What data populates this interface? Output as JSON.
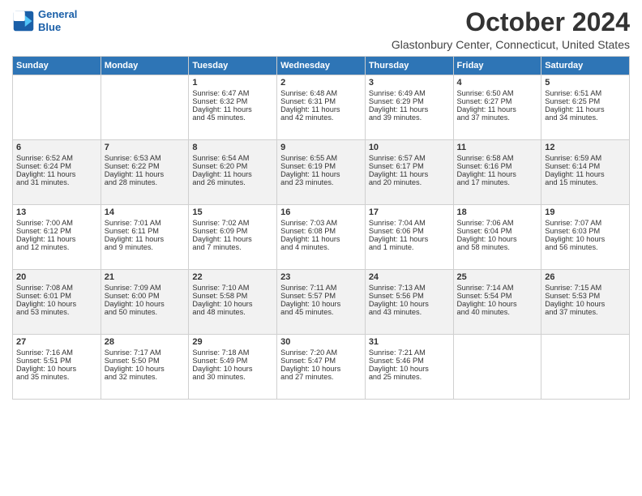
{
  "logo": {
    "line1": "General",
    "line2": "Blue"
  },
  "title": "October 2024",
  "location": "Glastonbury Center, Connecticut, United States",
  "headers": [
    "Sunday",
    "Monday",
    "Tuesday",
    "Wednesday",
    "Thursday",
    "Friday",
    "Saturday"
  ],
  "weeks": [
    [
      {
        "day": "",
        "lines": []
      },
      {
        "day": "",
        "lines": []
      },
      {
        "day": "1",
        "lines": [
          "Sunrise: 6:47 AM",
          "Sunset: 6:32 PM",
          "Daylight: 11 hours",
          "and 45 minutes."
        ]
      },
      {
        "day": "2",
        "lines": [
          "Sunrise: 6:48 AM",
          "Sunset: 6:31 PM",
          "Daylight: 11 hours",
          "and 42 minutes."
        ]
      },
      {
        "day": "3",
        "lines": [
          "Sunrise: 6:49 AM",
          "Sunset: 6:29 PM",
          "Daylight: 11 hours",
          "and 39 minutes."
        ]
      },
      {
        "day": "4",
        "lines": [
          "Sunrise: 6:50 AM",
          "Sunset: 6:27 PM",
          "Daylight: 11 hours",
          "and 37 minutes."
        ]
      },
      {
        "day": "5",
        "lines": [
          "Sunrise: 6:51 AM",
          "Sunset: 6:25 PM",
          "Daylight: 11 hours",
          "and 34 minutes."
        ]
      }
    ],
    [
      {
        "day": "6",
        "lines": [
          "Sunrise: 6:52 AM",
          "Sunset: 6:24 PM",
          "Daylight: 11 hours",
          "and 31 minutes."
        ]
      },
      {
        "day": "7",
        "lines": [
          "Sunrise: 6:53 AM",
          "Sunset: 6:22 PM",
          "Daylight: 11 hours",
          "and 28 minutes."
        ]
      },
      {
        "day": "8",
        "lines": [
          "Sunrise: 6:54 AM",
          "Sunset: 6:20 PM",
          "Daylight: 11 hours",
          "and 26 minutes."
        ]
      },
      {
        "day": "9",
        "lines": [
          "Sunrise: 6:55 AM",
          "Sunset: 6:19 PM",
          "Daylight: 11 hours",
          "and 23 minutes."
        ]
      },
      {
        "day": "10",
        "lines": [
          "Sunrise: 6:57 AM",
          "Sunset: 6:17 PM",
          "Daylight: 11 hours",
          "and 20 minutes."
        ]
      },
      {
        "day": "11",
        "lines": [
          "Sunrise: 6:58 AM",
          "Sunset: 6:16 PM",
          "Daylight: 11 hours",
          "and 17 minutes."
        ]
      },
      {
        "day": "12",
        "lines": [
          "Sunrise: 6:59 AM",
          "Sunset: 6:14 PM",
          "Daylight: 11 hours",
          "and 15 minutes."
        ]
      }
    ],
    [
      {
        "day": "13",
        "lines": [
          "Sunrise: 7:00 AM",
          "Sunset: 6:12 PM",
          "Daylight: 11 hours",
          "and 12 minutes."
        ]
      },
      {
        "day": "14",
        "lines": [
          "Sunrise: 7:01 AM",
          "Sunset: 6:11 PM",
          "Daylight: 11 hours",
          "and 9 minutes."
        ]
      },
      {
        "day": "15",
        "lines": [
          "Sunrise: 7:02 AM",
          "Sunset: 6:09 PM",
          "Daylight: 11 hours",
          "and 7 minutes."
        ]
      },
      {
        "day": "16",
        "lines": [
          "Sunrise: 7:03 AM",
          "Sunset: 6:08 PM",
          "Daylight: 11 hours",
          "and 4 minutes."
        ]
      },
      {
        "day": "17",
        "lines": [
          "Sunrise: 7:04 AM",
          "Sunset: 6:06 PM",
          "Daylight: 11 hours",
          "and 1 minute."
        ]
      },
      {
        "day": "18",
        "lines": [
          "Sunrise: 7:06 AM",
          "Sunset: 6:04 PM",
          "Daylight: 10 hours",
          "and 58 minutes."
        ]
      },
      {
        "day": "19",
        "lines": [
          "Sunrise: 7:07 AM",
          "Sunset: 6:03 PM",
          "Daylight: 10 hours",
          "and 56 minutes."
        ]
      }
    ],
    [
      {
        "day": "20",
        "lines": [
          "Sunrise: 7:08 AM",
          "Sunset: 6:01 PM",
          "Daylight: 10 hours",
          "and 53 minutes."
        ]
      },
      {
        "day": "21",
        "lines": [
          "Sunrise: 7:09 AM",
          "Sunset: 6:00 PM",
          "Daylight: 10 hours",
          "and 50 minutes."
        ]
      },
      {
        "day": "22",
        "lines": [
          "Sunrise: 7:10 AM",
          "Sunset: 5:58 PM",
          "Daylight: 10 hours",
          "and 48 minutes."
        ]
      },
      {
        "day": "23",
        "lines": [
          "Sunrise: 7:11 AM",
          "Sunset: 5:57 PM",
          "Daylight: 10 hours",
          "and 45 minutes."
        ]
      },
      {
        "day": "24",
        "lines": [
          "Sunrise: 7:13 AM",
          "Sunset: 5:56 PM",
          "Daylight: 10 hours",
          "and 43 minutes."
        ]
      },
      {
        "day": "25",
        "lines": [
          "Sunrise: 7:14 AM",
          "Sunset: 5:54 PM",
          "Daylight: 10 hours",
          "and 40 minutes."
        ]
      },
      {
        "day": "26",
        "lines": [
          "Sunrise: 7:15 AM",
          "Sunset: 5:53 PM",
          "Daylight: 10 hours",
          "and 37 minutes."
        ]
      }
    ],
    [
      {
        "day": "27",
        "lines": [
          "Sunrise: 7:16 AM",
          "Sunset: 5:51 PM",
          "Daylight: 10 hours",
          "and 35 minutes."
        ]
      },
      {
        "day": "28",
        "lines": [
          "Sunrise: 7:17 AM",
          "Sunset: 5:50 PM",
          "Daylight: 10 hours",
          "and 32 minutes."
        ]
      },
      {
        "day": "29",
        "lines": [
          "Sunrise: 7:18 AM",
          "Sunset: 5:49 PM",
          "Daylight: 10 hours",
          "and 30 minutes."
        ]
      },
      {
        "day": "30",
        "lines": [
          "Sunrise: 7:20 AM",
          "Sunset: 5:47 PM",
          "Daylight: 10 hours",
          "and 27 minutes."
        ]
      },
      {
        "day": "31",
        "lines": [
          "Sunrise: 7:21 AM",
          "Sunset: 5:46 PM",
          "Daylight: 10 hours",
          "and 25 minutes."
        ]
      },
      {
        "day": "",
        "lines": []
      },
      {
        "day": "",
        "lines": []
      }
    ]
  ]
}
